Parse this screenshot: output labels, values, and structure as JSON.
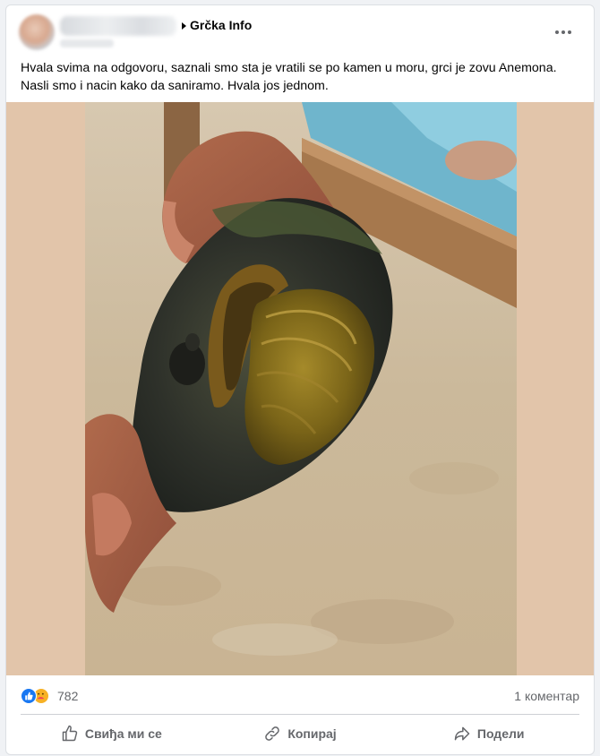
{
  "post": {
    "group_name": "Grčka Info",
    "text": "Hvala svima na odgovoru, saznali smo sta je vratili se po kamen u moru, grci je zovu Anemona.\nNasli smo i nacin kako da saniramo. Hvala jos jednom."
  },
  "stats": {
    "reactions_count": "782",
    "reaction_icons": [
      "like-icon",
      "care-icon"
    ],
    "comments": "1 коментар"
  },
  "actions": {
    "like": "Свиђа ми се",
    "copy": "Копирај",
    "share": "Подели"
  },
  "colors": {
    "accent": "#1877f2",
    "secondary_text": "#65676b",
    "photo_border": "#e2c5aa"
  }
}
